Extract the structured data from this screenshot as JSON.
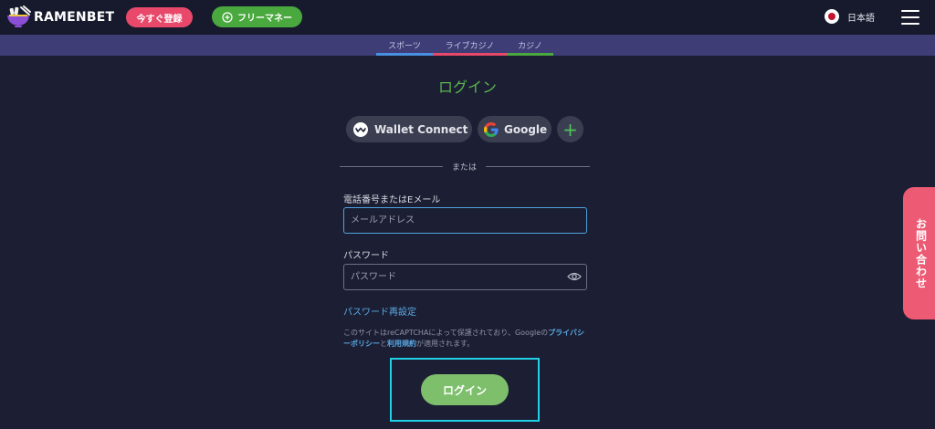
{
  "header": {
    "brand": "RAMENBET",
    "register_label": "今すぐ登録",
    "free_money_label": "フリーマネー",
    "language": "日本語"
  },
  "subnav": {
    "tabs": [
      {
        "label": "スポーツ",
        "color": "#4a90e2"
      },
      {
        "label": "ライブカジノ",
        "color": "#e8496a"
      },
      {
        "label": "カジノ",
        "color": "#49a93e"
      }
    ]
  },
  "login": {
    "title": "ログイン",
    "social": {
      "wallet_connect": "Wallet Connect",
      "google": "Google",
      "more": "+"
    },
    "or_text": "または",
    "email_label": "電話番号またはEメール",
    "email_placeholder": "メールアドレス",
    "password_label": "パスワード",
    "password_placeholder": "パスワード",
    "reset_link": "パスワード再設定",
    "recaptcha": {
      "prefix": "このサイトはreCAPTCHAによって保護されており、Googleの",
      "privacy_link": "プライバシーポリシー",
      "and": "と",
      "terms_link": "利用規約",
      "suffix": "が適用されます。"
    },
    "submit_label": "ログイン"
  },
  "contact_tab": "お問い合わせ",
  "colors": {
    "background": "#1c1f33",
    "accent_green": "#5bb64f",
    "accent_pink": "#e8496a",
    "link_blue": "#5aa9e6",
    "highlight": "#1fd0e6"
  }
}
